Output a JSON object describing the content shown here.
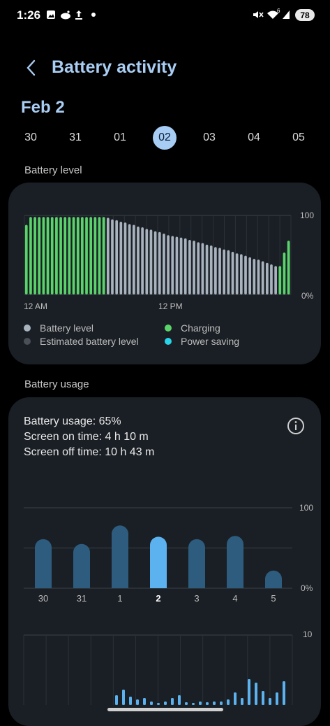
{
  "status_bar": {
    "time": "1:26",
    "battery": "78",
    "signal_label": "6"
  },
  "header": {
    "title": "Battery activity"
  },
  "date_heading": "Feb 2",
  "date_strip": {
    "dates": [
      "30",
      "31",
      "01",
      "02",
      "03",
      "04",
      "05"
    ],
    "selected_index": 3
  },
  "battery_level": {
    "section_label": "Battery level",
    "y_top": "100",
    "y_bottom": "0%",
    "x_labels": [
      "12 AM",
      "12 PM"
    ],
    "legend": [
      {
        "label": "Battery level",
        "color": "#a9b3be"
      },
      {
        "label": "Estimated battery level",
        "color": "#4a5057"
      },
      {
        "label": "Charging",
        "color": "#5ad46a"
      },
      {
        "label": "Power saving",
        "color": "#2ad4e8"
      }
    ]
  },
  "battery_usage": {
    "section_label": "Battery usage",
    "usage_text": "Battery usage: 65%",
    "screen_on": "Screen on time: 4 h 10 m",
    "screen_off": "Screen off time: 10 h 43 m",
    "y_top": "100",
    "y_bottom": "0%",
    "hourly_top": "10"
  },
  "chart_data": [
    {
      "type": "bar",
      "title": "Battery level",
      "ylim": [
        0,
        100
      ],
      "series": [
        {
          "name": "Charging",
          "color": "#5ad46a",
          "values": [
            88,
            98,
            98,
            98,
            98,
            98,
            98,
            98,
            98,
            98,
            98,
            98,
            98,
            98,
            98,
            98,
            98,
            98,
            98,
            null,
            null,
            null,
            null,
            null,
            null,
            null,
            null,
            null,
            null,
            null,
            null,
            null,
            null,
            null,
            null,
            null,
            null,
            null,
            null,
            null,
            null,
            null,
            null,
            null,
            null,
            null,
            null,
            null,
            null,
            null,
            null,
            null,
            null,
            null,
            null,
            null,
            null,
            null,
            null,
            36,
            53,
            68
          ]
        },
        {
          "name": "Battery level",
          "color": "#a9b3be",
          "values": [
            null,
            null,
            null,
            null,
            null,
            null,
            null,
            null,
            null,
            null,
            null,
            null,
            null,
            null,
            null,
            null,
            null,
            null,
            null,
            97,
            95,
            94,
            92,
            91,
            89,
            88,
            86,
            85,
            83,
            82,
            80,
            79,
            77,
            75,
            74,
            73,
            72,
            71,
            69,
            68,
            66,
            65,
            63,
            62,
            60,
            59,
            57,
            56,
            54,
            52,
            51,
            49,
            47,
            45,
            44,
            42,
            40,
            38,
            36,
            null,
            null,
            null
          ]
        }
      ]
    },
    {
      "type": "bar",
      "title": "Battery usage",
      "categories": [
        "30",
        "31",
        "1",
        "2",
        "3",
        "4",
        "5"
      ],
      "ylim": [
        0,
        100
      ],
      "values": [
        61,
        55,
        78,
        64,
        61,
        65,
        22
      ],
      "selected": "2"
    },
    {
      "type": "bar",
      "title": "Hourly usage",
      "ylim": [
        0,
        10
      ],
      "values": [
        1.4,
        2.2,
        1.2,
        0.8,
        1.0,
        0.5,
        0.3,
        0.5,
        1.0,
        1.4,
        0.4,
        0.3,
        0.5,
        0.4,
        0.5,
        0.5,
        0.8,
        1.8,
        1.0,
        3.7,
        3.2,
        2.0,
        1.0,
        1.8,
        3.4
      ]
    }
  ]
}
